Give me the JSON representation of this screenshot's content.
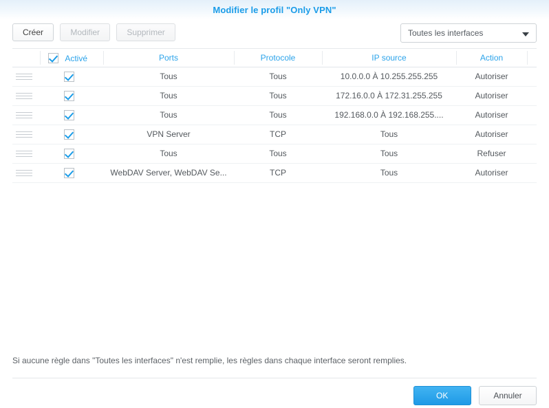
{
  "dialog": {
    "title": "Modifier le profil \"Only VPN\""
  },
  "toolbar": {
    "create_label": "Créer",
    "edit_label": "Modifier",
    "delete_label": "Supprimer",
    "interface_select": {
      "value": "Toutes les interfaces",
      "icon": "chevron-down-icon"
    }
  },
  "grid": {
    "header_checkbox_checked": true,
    "columns": [
      {
        "key": "enabled",
        "label": "Activé"
      },
      {
        "key": "ports",
        "label": "Ports"
      },
      {
        "key": "protocol",
        "label": "Protocole"
      },
      {
        "key": "ipsource",
        "label": "IP source"
      },
      {
        "key": "action",
        "label": "Action"
      }
    ],
    "rows": [
      {
        "enabled": true,
        "ports": "Tous",
        "protocol": "Tous",
        "ipsource": "10.0.0.0 À 10.255.255.255",
        "action": "Autoriser"
      },
      {
        "enabled": true,
        "ports": "Tous",
        "protocol": "Tous",
        "ipsource": "172.16.0.0 À 172.31.255.255",
        "action": "Autoriser"
      },
      {
        "enabled": true,
        "ports": "Tous",
        "protocol": "Tous",
        "ipsource": "192.168.0.0 À 192.168.255....",
        "action": "Autoriser"
      },
      {
        "enabled": true,
        "ports": "VPN Server",
        "protocol": "TCP",
        "ipsource": "Tous",
        "action": "Autoriser"
      },
      {
        "enabled": true,
        "ports": "Tous",
        "protocol": "Tous",
        "ipsource": "Tous",
        "action": "Refuser"
      },
      {
        "enabled": true,
        "ports": "WebDAV Server, WebDAV Se...",
        "protocol": "TCP",
        "ipsource": "Tous",
        "action": "Autoriser"
      }
    ]
  },
  "footnote": {
    "text": "Si aucune règle dans \"Toutes les interfaces\" n'est remplie, les règles dans chaque interface seront remplies."
  },
  "footer": {
    "ok_label": "OK",
    "cancel_label": "Annuler"
  },
  "colors": {
    "accent": "#1a9ce8",
    "header_text": "#2ba3ea",
    "body_text": "#53585d",
    "primary_button": "#1f9ae6"
  }
}
